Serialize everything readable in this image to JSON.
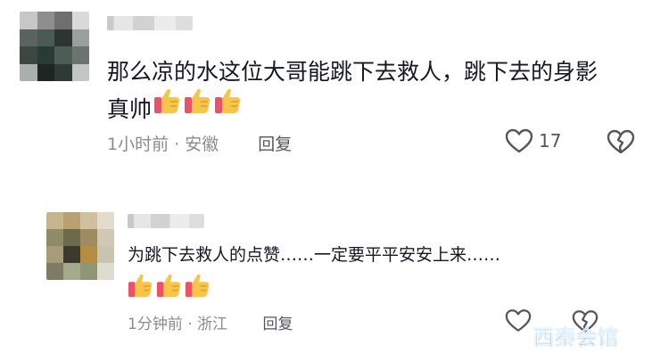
{
  "comments": [
    {
      "text_line1": "那么凉的水这位大哥能跳下去救人，跳下去的身影",
      "text_line2": "真帅",
      "emoji_count": 3,
      "time": "1小时前",
      "separator": "·",
      "location": "安徽",
      "reply_label": "回复",
      "like_count": "17"
    },
    {
      "text_line1": "为跳下去救人的点赞……一定要平平安安上来……",
      "emoji_count": 3,
      "time": "1分钟前",
      "separator": "·",
      "location": "浙江",
      "reply_label": "回复",
      "like_count": ""
    }
  ],
  "watermark": "西秦会馆",
  "colors": {
    "text": "#161823",
    "meta": "#8a8b91",
    "watermark": "#2f8bf0"
  },
  "icons": [
    "thumbs-up-emoji",
    "heart-outline-icon",
    "broken-heart-icon"
  ]
}
